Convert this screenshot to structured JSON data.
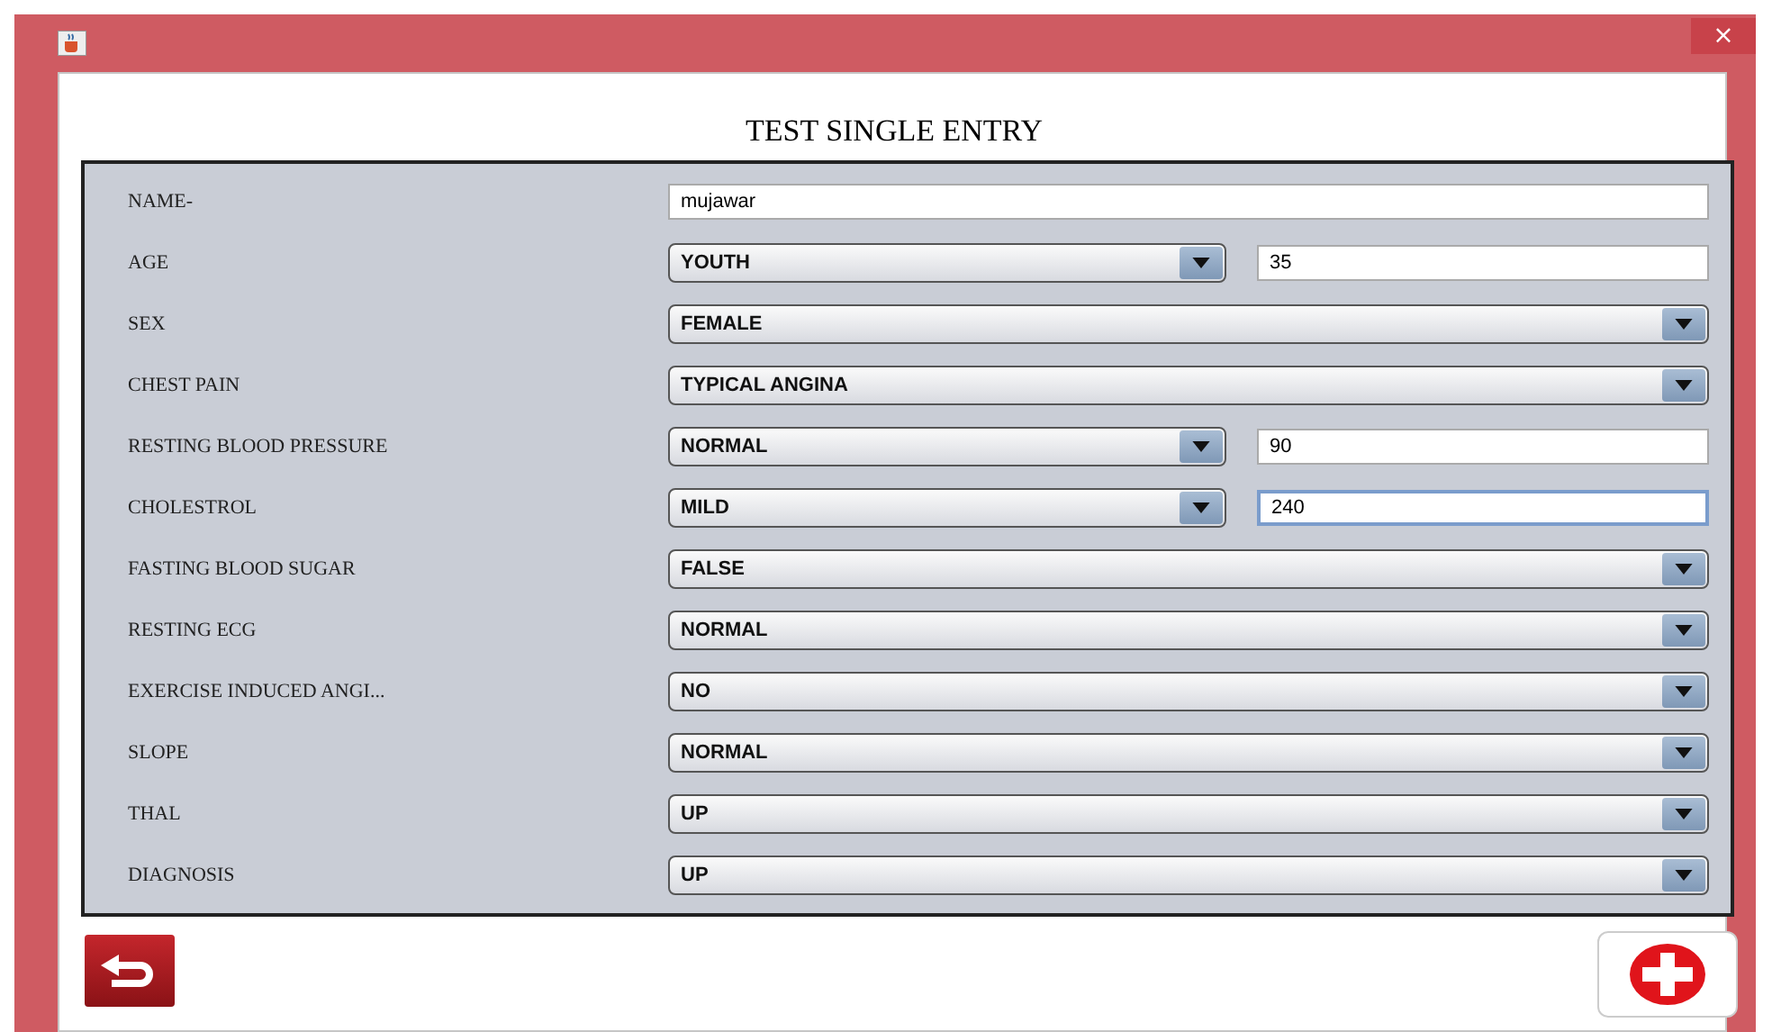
{
  "window": {
    "close": "×"
  },
  "form": {
    "title": "TEST SINGLE ENTRY",
    "rows": [
      {
        "kind": "text",
        "label": "NAME-",
        "value": "mujawar"
      },
      {
        "kind": "combo_text",
        "label": "AGE",
        "value": "YOUTH",
        "field": "35",
        "focused": false
      },
      {
        "kind": "combo",
        "label": "SEX",
        "value": "FEMALE"
      },
      {
        "kind": "combo",
        "label": "CHEST PAIN",
        "value": "TYPICAL ANGINA"
      },
      {
        "kind": "combo_text",
        "label": "RESTING BLOOD PRESSURE",
        "value": "NORMAL",
        "field": "90",
        "focused": false
      },
      {
        "kind": "combo_text",
        "label": "CHOLESTROL",
        "value": "MILD",
        "field": "240",
        "focused": true
      },
      {
        "kind": "combo",
        "label": "FASTING BLOOD SUGAR",
        "value": "FALSE"
      },
      {
        "kind": "combo",
        "label": "RESTING ECG",
        "value": "NORMAL"
      },
      {
        "kind": "combo",
        "label": "EXERCISE INDUCED ANGI...",
        "value": "NO"
      },
      {
        "kind": "combo",
        "label": "SLOPE",
        "value": "NORMAL"
      },
      {
        "kind": "combo",
        "label": "THAL",
        "value": "UP"
      },
      {
        "kind": "combo",
        "label": "DIAGNOSIS",
        "value": "UP"
      }
    ]
  }
}
